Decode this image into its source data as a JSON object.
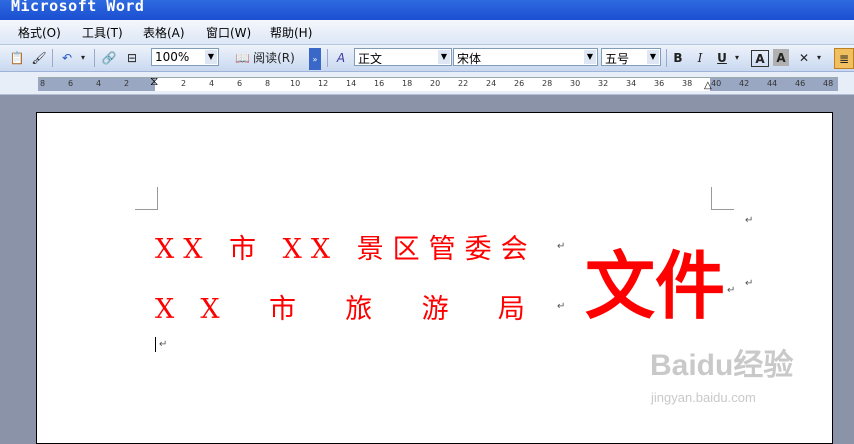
{
  "window": {
    "title": "Microsoft Word"
  },
  "menubar": {
    "items": [
      "格式(O)",
      "工具(T)",
      "表格(A)",
      "窗口(W)",
      "帮助(H)"
    ]
  },
  "toolbar": {
    "zoom": "100%",
    "read_label": "阅读(R)",
    "style": "正文",
    "font": "宋体",
    "size": "五号",
    "bold_label": "B",
    "italic_label": "I",
    "underline_label": "U",
    "border_label": "A",
    "shade_label": "A"
  },
  "ruler": {
    "left_ticks": [
      "8",
      "6",
      "4",
      "2"
    ],
    "ticks": [
      "2",
      "4",
      "6",
      "8",
      "10",
      "12",
      "14",
      "16",
      "18",
      "20",
      "22",
      "24",
      "26",
      "28",
      "30",
      "32",
      "34",
      "36",
      "38",
      "40",
      "42",
      "44",
      "46",
      "48"
    ]
  },
  "document": {
    "line1": "XX 市 XX 景区管委会",
    "line2": "X  X    市    旅    游    局",
    "big_text": "文件",
    "para_mark": "↵"
  },
  "watermark": {
    "brand": "Baidu经验",
    "url": "jingyan.baidu.com"
  }
}
